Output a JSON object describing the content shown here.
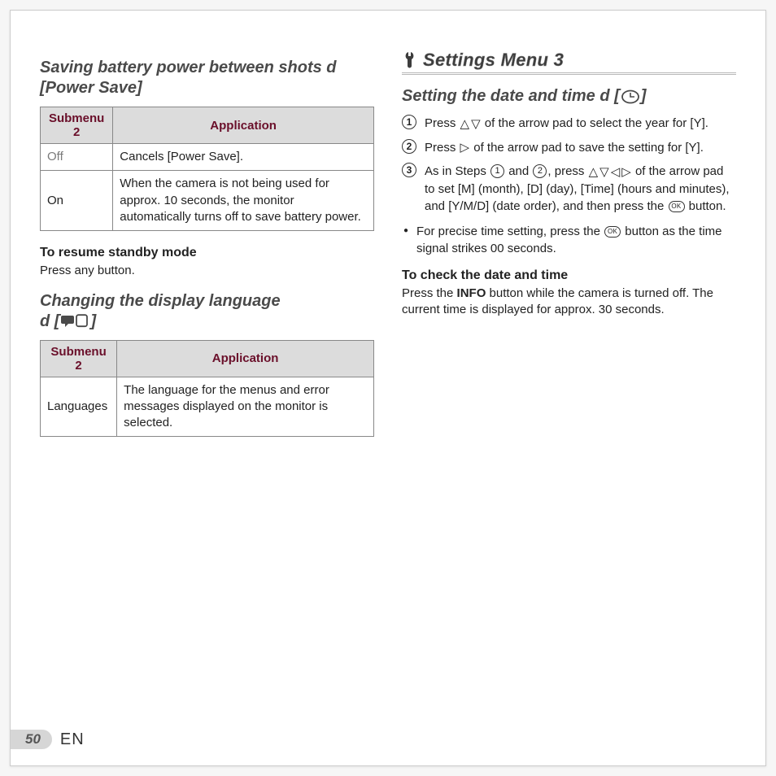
{
  "left": {
    "h1": "Saving battery power between shots d [Power Save]",
    "table1": {
      "headers": [
        "Submenu 2",
        "Application"
      ],
      "rows": [
        {
          "c1": "Off",
          "c2": "Cancels [Power Save]."
        },
        {
          "c1": "On",
          "c2": "When the camera is not being used for approx. 10 seconds, the monitor automatically turns off to save battery power."
        }
      ]
    },
    "sub1": "To resume standby mode",
    "sub1_body": "Press any button.",
    "h2_a": "Changing the display language",
    "h2_b": "d [",
    "h2_c": "]",
    "table2": {
      "headers": [
        "Submenu 2",
        "Application"
      ],
      "rows": [
        {
          "c1": "Languages",
          "c2": "The language for the menus and error messages displayed on the monitor is selected."
        }
      ]
    }
  },
  "right": {
    "section_title": "Settings Menu 3",
    "h1_a": "Setting the date and time d [",
    "h1_b": "]",
    "steps": {
      "s1_a": "Press ",
      "s1_b": " of the arrow pad to select the year for [Y].",
      "s2_a": "Press ",
      "s2_b": " of the arrow pad to save the setting for [Y].",
      "s3_a": "As in Steps ",
      "s3_b": " and ",
      "s3_c": ", press ",
      "s3_d": " of the arrow pad to set [M] (month), [D] (day), [Time] (hours and minutes), and [Y/M/D] (date order), and then press the ",
      "s3_e": " button."
    },
    "bullet_a": "For precise time setting, press the ",
    "bullet_b": " button as the time signal strikes 00 seconds.",
    "sub1": "To check the date and time",
    "sub1_body_a": "Press the ",
    "sub1_body_b": "INFO",
    "sub1_body_c": " button while the camera is turned off. The current time is displayed for approx. 30 seconds."
  },
  "footer": {
    "page": "50",
    "lang": "EN"
  },
  "glyphs": {
    "up": "△",
    "down": "▽",
    "left": "◁",
    "right": "▷",
    "ok": "OK",
    "n1": "1",
    "n2": "2",
    "n3": "3"
  }
}
